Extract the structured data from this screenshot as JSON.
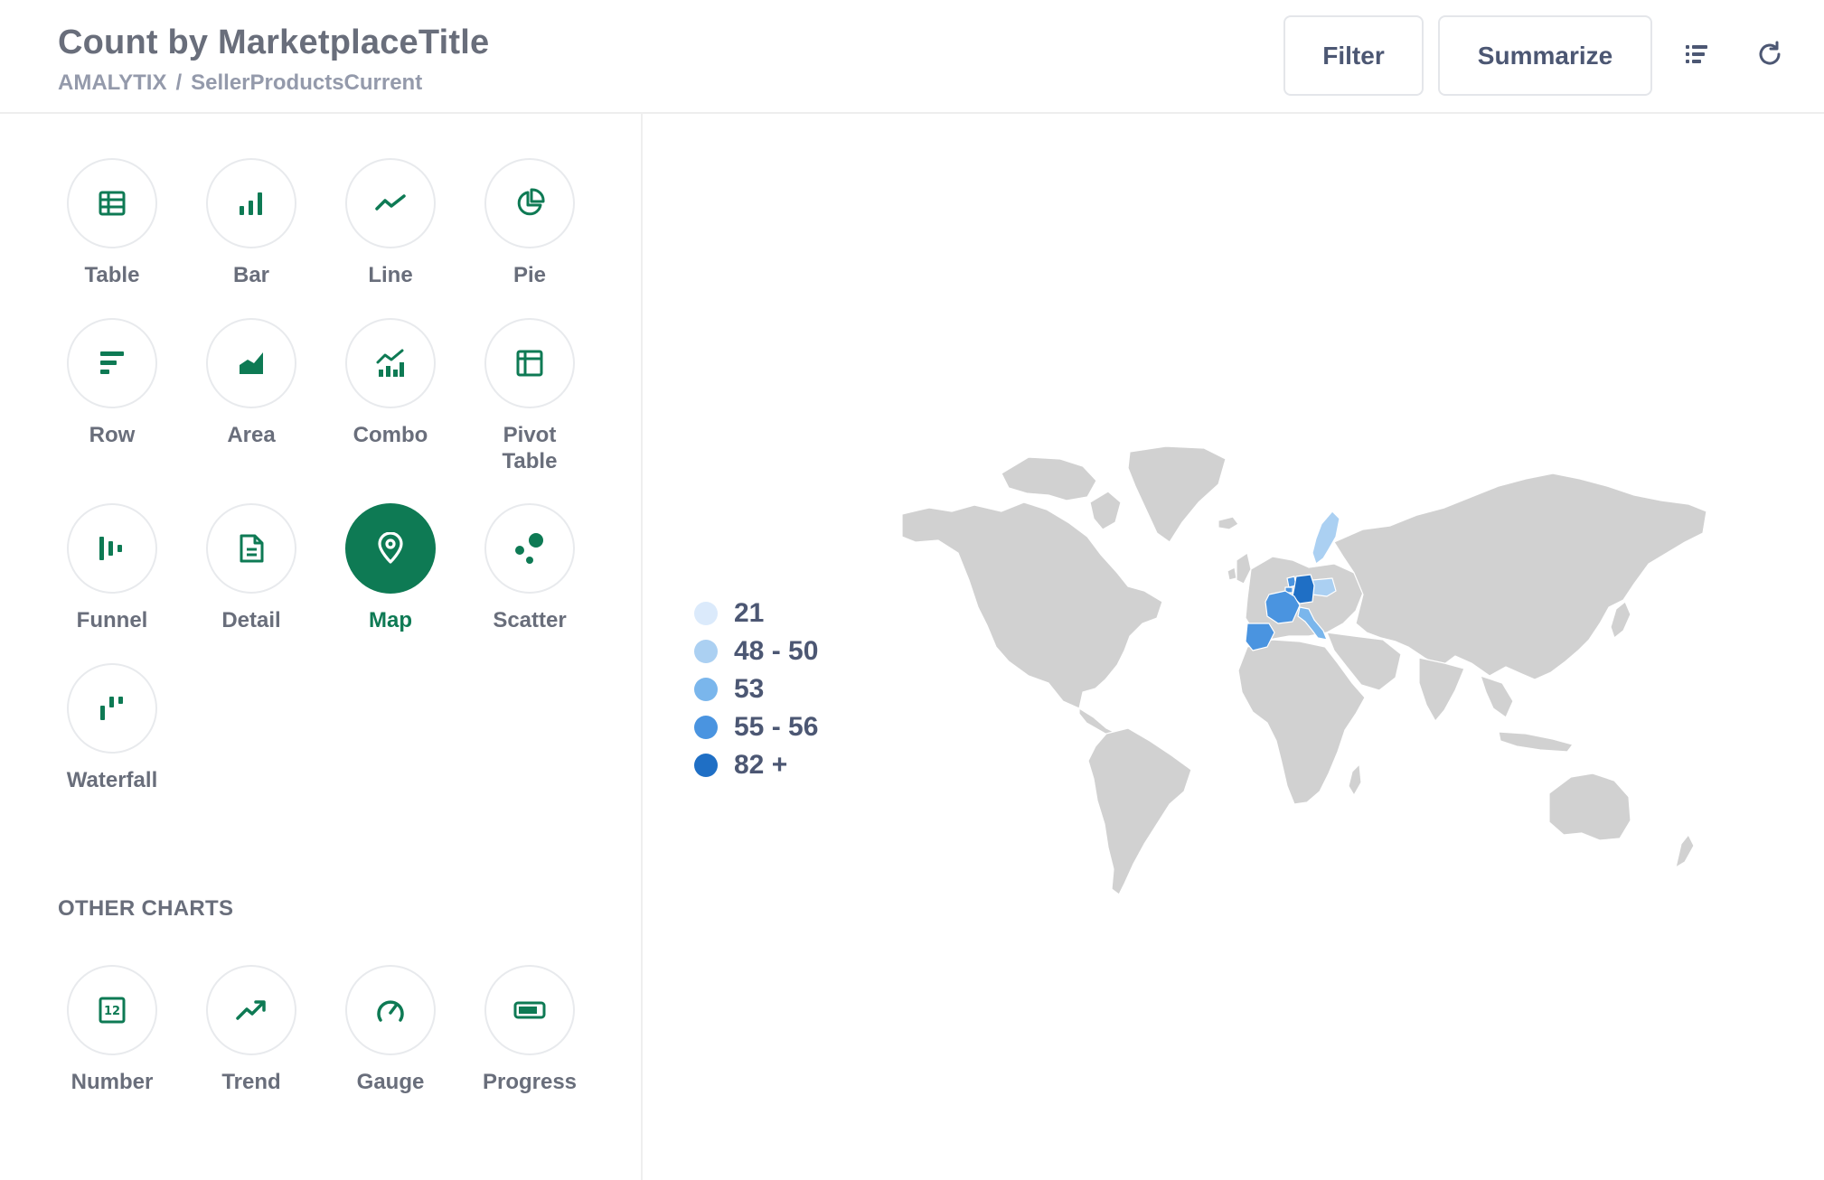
{
  "header": {
    "title": "Count by MarketplaceTitle",
    "breadcrumb": {
      "database": "AMALYTIX",
      "separator": "/",
      "table": "SellerProductsCurrent"
    },
    "filter_label": "Filter",
    "summarize_label": "Summarize",
    "icons": [
      "list-icon",
      "refresh-icon"
    ]
  },
  "chart_types": [
    {
      "label": "Table",
      "icon": "table-icon",
      "selected": false
    },
    {
      "label": "Bar",
      "icon": "bar-chart-icon",
      "selected": false
    },
    {
      "label": "Line",
      "icon": "line-chart-icon",
      "selected": false
    },
    {
      "label": "Pie",
      "icon": "pie-chart-icon",
      "selected": false
    },
    {
      "label": "Row",
      "icon": "row-chart-icon",
      "selected": false
    },
    {
      "label": "Area",
      "icon": "area-chart-icon",
      "selected": false
    },
    {
      "label": "Combo",
      "icon": "combo-chart-icon",
      "selected": false
    },
    {
      "label": "Pivot Table",
      "icon": "pivot-table-icon",
      "selected": false
    },
    {
      "label": "Funnel",
      "icon": "funnel-icon",
      "selected": false
    },
    {
      "label": "Detail",
      "icon": "detail-icon",
      "selected": false
    },
    {
      "label": "Map",
      "icon": "map-pin-icon",
      "selected": true
    },
    {
      "label": "Scatter",
      "icon": "scatter-icon",
      "selected": false
    },
    {
      "label": "Waterfall",
      "icon": "waterfall-icon",
      "selected": false
    }
  ],
  "other_charts_heading": "OTHER CHARTS",
  "other_charts": [
    {
      "label": "Number",
      "icon": "number-icon"
    },
    {
      "label": "Trend",
      "icon": "trend-icon"
    },
    {
      "label": "Gauge",
      "icon": "gauge-icon"
    },
    {
      "label": "Progress",
      "icon": "progress-icon"
    }
  ],
  "legend": [
    {
      "label": "21",
      "color": "#dbeafb"
    },
    {
      "label": "48 - 50",
      "color": "#abd0f2"
    },
    {
      "label": "53",
      "color": "#7ab6ec"
    },
    {
      "label": "55 - 56",
      "color": "#4a94e0"
    },
    {
      "label": "82 +",
      "color": "#1f6fc5"
    }
  ],
  "colors": {
    "brand": "#0e7a54",
    "land": "#d1d1d1",
    "text": "#4c5773"
  }
}
